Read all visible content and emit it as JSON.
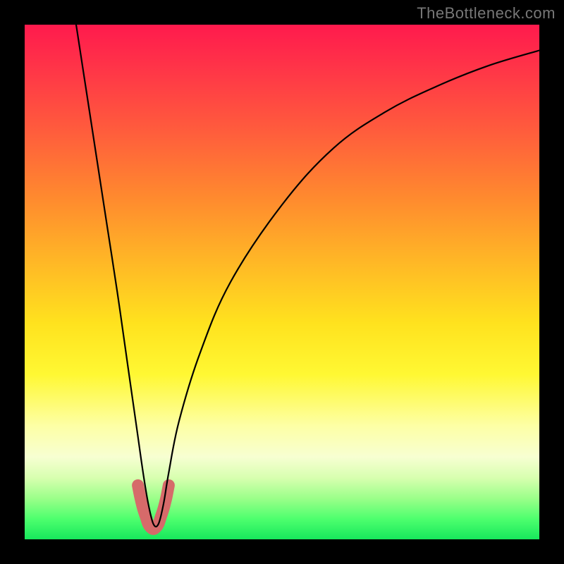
{
  "watermark": "TheBottleneck.com",
  "chart_data": {
    "type": "line",
    "title": "",
    "xlabel": "",
    "ylabel": "",
    "xlim": [
      0,
      100
    ],
    "ylim": [
      0,
      100
    ],
    "grid": false,
    "legend": false,
    "series": [
      {
        "name": "black-curve",
        "color": "#000000",
        "x": [
          10,
          12,
          14,
          16,
          18,
          20,
          21,
          22,
          23,
          24,
          25,
          26,
          27,
          28,
          30,
          34,
          40,
          50,
          60,
          70,
          80,
          90,
          100
        ],
        "values": [
          100,
          87,
          74,
          61,
          48,
          34,
          27,
          20,
          13,
          7,
          3,
          3,
          7,
          13,
          23,
          36,
          50,
          65,
          76,
          83,
          88,
          92,
          95
        ]
      },
      {
        "name": "salmon-band",
        "color": "#d66a6a",
        "x": [
          22.0,
          22.5,
          23.0,
          23.5,
          24.0,
          24.5,
          25.0,
          25.5,
          26.0,
          26.5,
          27.0,
          27.5,
          28.0
        ],
        "values": [
          10.5,
          8.0,
          6.0,
          4.5,
          3.0,
          2.3,
          2.0,
          2.3,
          3.0,
          4.5,
          6.0,
          8.0,
          10.5
        ]
      }
    ],
    "notes": "x and values are in percent of the plotting area (0–100). values is distance from the bottom edge; the curve depicts a steep V dipping to ~2% near x≈25 with an asymmetric right branch that levels off near y≈95 at x=100. The salmon band is a thick stroke tracing the bottom of the V."
  }
}
